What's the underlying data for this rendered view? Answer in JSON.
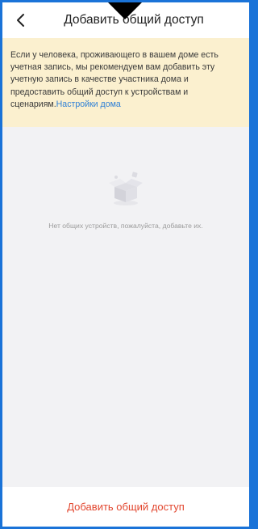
{
  "header": {
    "title": "Добавить общий доступ",
    "back_icon": "chevron-left-icon"
  },
  "notice": {
    "text": "Если у человека, проживающего в вашем доме есть учетная запись, мы рекомендуем вам добавить эту учетную запись в качестве участника дома и предоставить общий доступ к устройствам и сценариям.",
    "link_label": "Настройки дома",
    "background_color": "#fbf0cf",
    "link_color": "#2d7fd6"
  },
  "empty_state": {
    "icon": "empty-box-icon",
    "message": "Нет общих устройств, пожалуйста, добавьте их."
  },
  "bottom_bar": {
    "add_button_label": "Добавить общий доступ",
    "accent_color": "#e2462e"
  }
}
